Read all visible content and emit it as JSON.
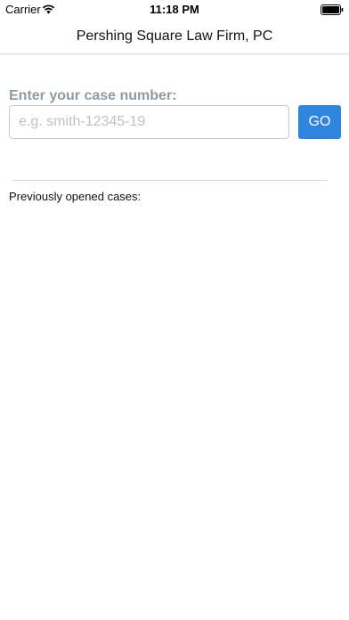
{
  "status_bar": {
    "carrier": "Carrier",
    "time": "11:18 PM",
    "icons": [
      "wifi-icon",
      "battery-icon"
    ]
  },
  "nav": {
    "title": "Pershing Square Law Firm, PC"
  },
  "case_form": {
    "label": "Enter your case number:",
    "input_value": "",
    "placeholder": "e.g. smith-12345-19",
    "go_label": "GO"
  },
  "previous_cases": {
    "label": "Previously opened cases:",
    "items": []
  },
  "colors": {
    "accent": "#2e86de",
    "label_gray": "#8e9aa6",
    "placeholder_gray": "#c1c1c1",
    "divider": "#d9d9d9"
  }
}
